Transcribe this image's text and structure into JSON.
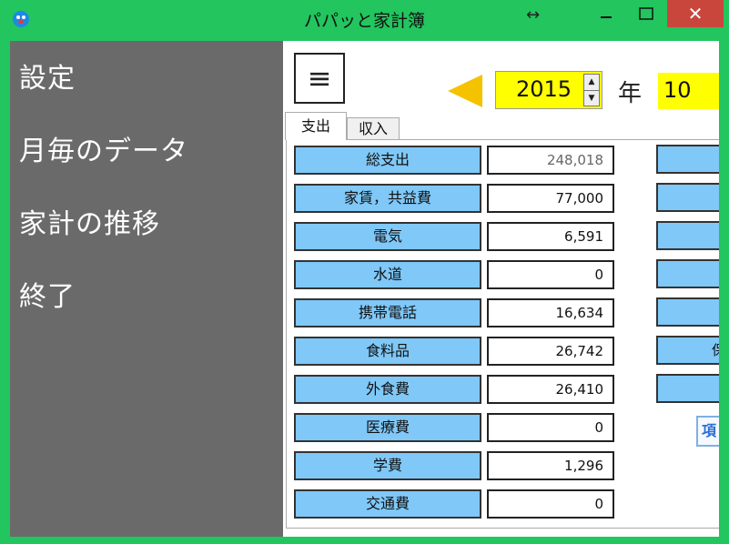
{
  "window": {
    "title": "パパッと家計簿",
    "app_icon": "app-face-icon",
    "resize_icon": "↔",
    "minimize_icon": "minimize-icon",
    "maximize_icon": "maximize-icon",
    "close_icon": "close-icon",
    "close_label": "✕"
  },
  "sidebar": {
    "items": [
      {
        "label": "設定"
      },
      {
        "label": "月毎のデータ"
      },
      {
        "label": "家計の推移"
      },
      {
        "label": "終了"
      }
    ]
  },
  "header": {
    "menu_icon": "≡",
    "prev_icon": "triangle-left-icon",
    "year_value": "2015",
    "year_unit": "年",
    "month_value": "10",
    "spin_up": "▲",
    "spin_down": "▼"
  },
  "tabs": [
    {
      "label": "支出",
      "active": true
    },
    {
      "label": "収入",
      "active": false
    }
  ],
  "expenses": [
    {
      "label": "総支出",
      "value": "248,018",
      "dim": true
    },
    {
      "label": "家賃，共益費",
      "value": "77,000"
    },
    {
      "label": "電気",
      "value": "6,591"
    },
    {
      "label": "水道",
      "value": "0"
    },
    {
      "label": "携帯電話",
      "value": "16,634"
    },
    {
      "label": "食料品",
      "value": "26,742"
    },
    {
      "label": "外食費",
      "value": "26,410"
    },
    {
      "label": "医療費",
      "value": "0"
    },
    {
      "label": "学費",
      "value": "1,296"
    },
    {
      "label": "交通費",
      "value": "0"
    }
  ],
  "right_column": {
    "items": [
      "",
      "",
      "",
      "",
      "",
      "保",
      ""
    ],
    "button_label": "項"
  },
  "colors": {
    "window_frame": "#22c55e",
    "sidebar": "#6a6a6a",
    "category_fill": "#7fc8f8",
    "year_fill": "#ffff00",
    "arrow": "#f5c200",
    "close_button": "#c9463d"
  }
}
